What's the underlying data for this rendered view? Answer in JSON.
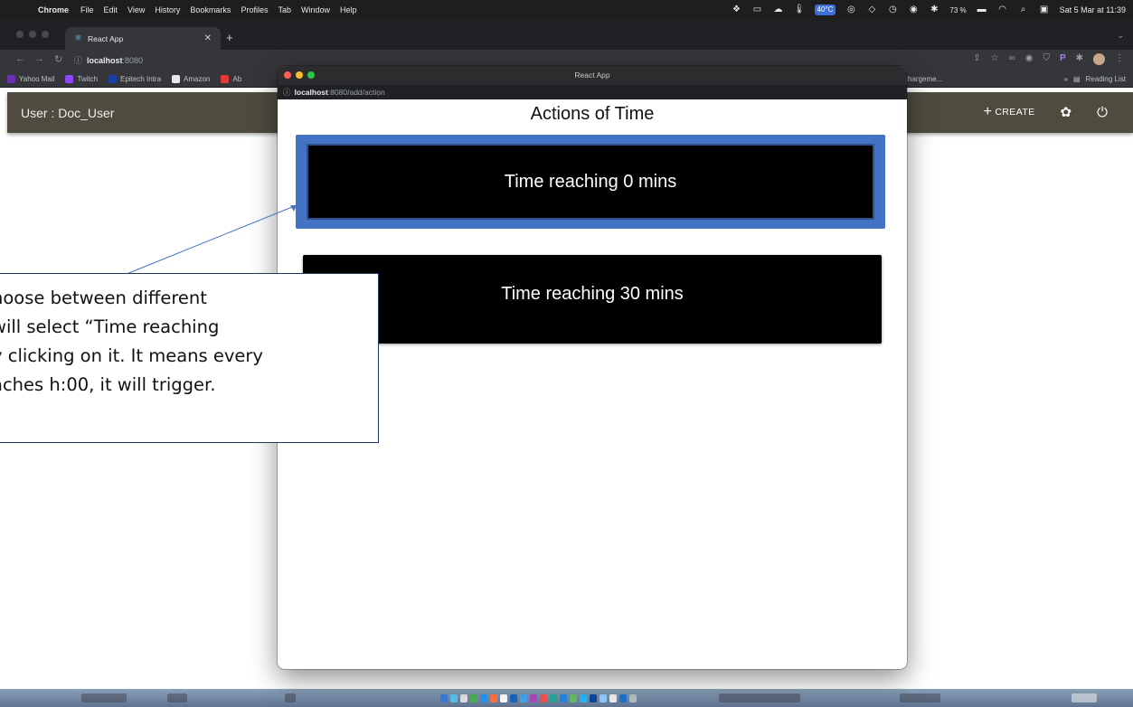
{
  "menubar": {
    "app_name": "Chrome",
    "items": [
      "File",
      "Edit",
      "View",
      "History",
      "Bookmarks",
      "Profiles",
      "Tab",
      "Window",
      "Help"
    ],
    "temperature": "40°C",
    "battery": "73 %",
    "datetime": "Sat 5 Mar at 11:39"
  },
  "browser": {
    "tab_title": "React App",
    "url_host": "localhost",
    "url_port": ":8080",
    "bookmarks": [
      "Yahoo Mail",
      "Twitch",
      "Epitech Intra",
      "Amazon",
      "Ab"
    ],
    "bookmark_right": "chargeme...",
    "reading_list": "Reading List"
  },
  "app": {
    "user_label": "User : Doc_User",
    "create_label": "CREATE"
  },
  "popup": {
    "window_title": "React App",
    "url_host": "localhost",
    "url_path": ":8080/add/action",
    "heading": "Actions of Time",
    "actions": [
      {
        "label": "Time reaching 0 mins",
        "selected": true
      },
      {
        "label": "Time reaching 30 mins",
        "selected": false
      }
    ]
  },
  "callout": {
    "lines": [
      "hoose between different",
      " will select “Time reaching",
      "y clicking on it. It means every",
      "aches h:00, it will trigger."
    ]
  },
  "colors": {
    "header_bg": "#504b3f",
    "selected_border": "#4473c5",
    "card_bg": "#000000"
  }
}
